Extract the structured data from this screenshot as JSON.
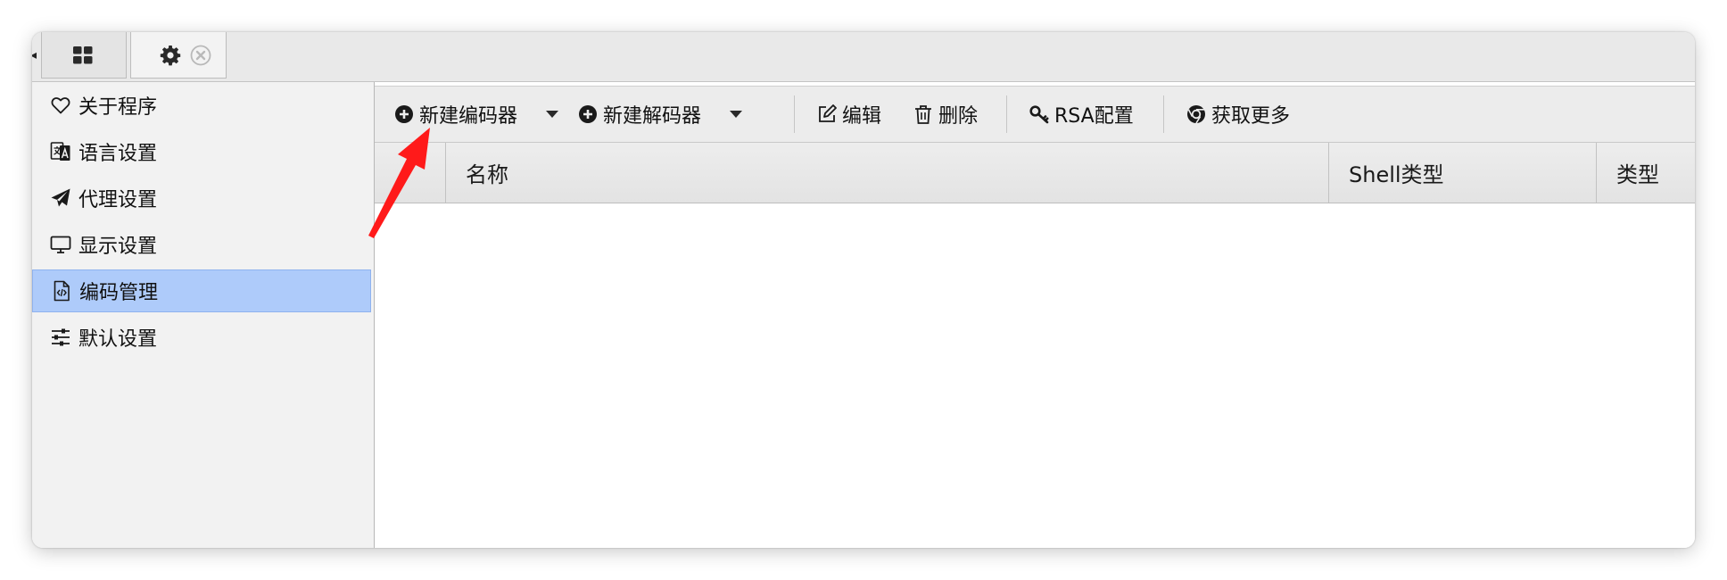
{
  "tabs": [
    {
      "icon": "grid-icon"
    },
    {
      "icon": "gear-icon",
      "close_icon": "close-icon"
    }
  ],
  "sidebar": {
    "items": [
      {
        "label": "关于程序",
        "icon": "heart-icon"
      },
      {
        "label": "语言设置",
        "icon": "translate-icon"
      },
      {
        "label": "代理设置",
        "icon": "paper-plane-icon"
      },
      {
        "label": "显示设置",
        "icon": "monitor-icon"
      },
      {
        "label": "编码管理",
        "icon": "code-file-icon",
        "selected": true
      },
      {
        "label": "默认设置",
        "icon": "sliders-icon"
      }
    ]
  },
  "toolbar": {
    "new_encoder": "新建编码器",
    "new_decoder": "新建解码器",
    "edit": "编辑",
    "delete": "删除",
    "rsa_config": "RSA配置",
    "get_more": "获取更多"
  },
  "table": {
    "columns": [
      "名称",
      "Shell类型",
      "类型"
    ],
    "rows": []
  },
  "colors": {
    "selected_bg": "#aecbfa",
    "annotation_arrow": "#ff1a1a"
  }
}
